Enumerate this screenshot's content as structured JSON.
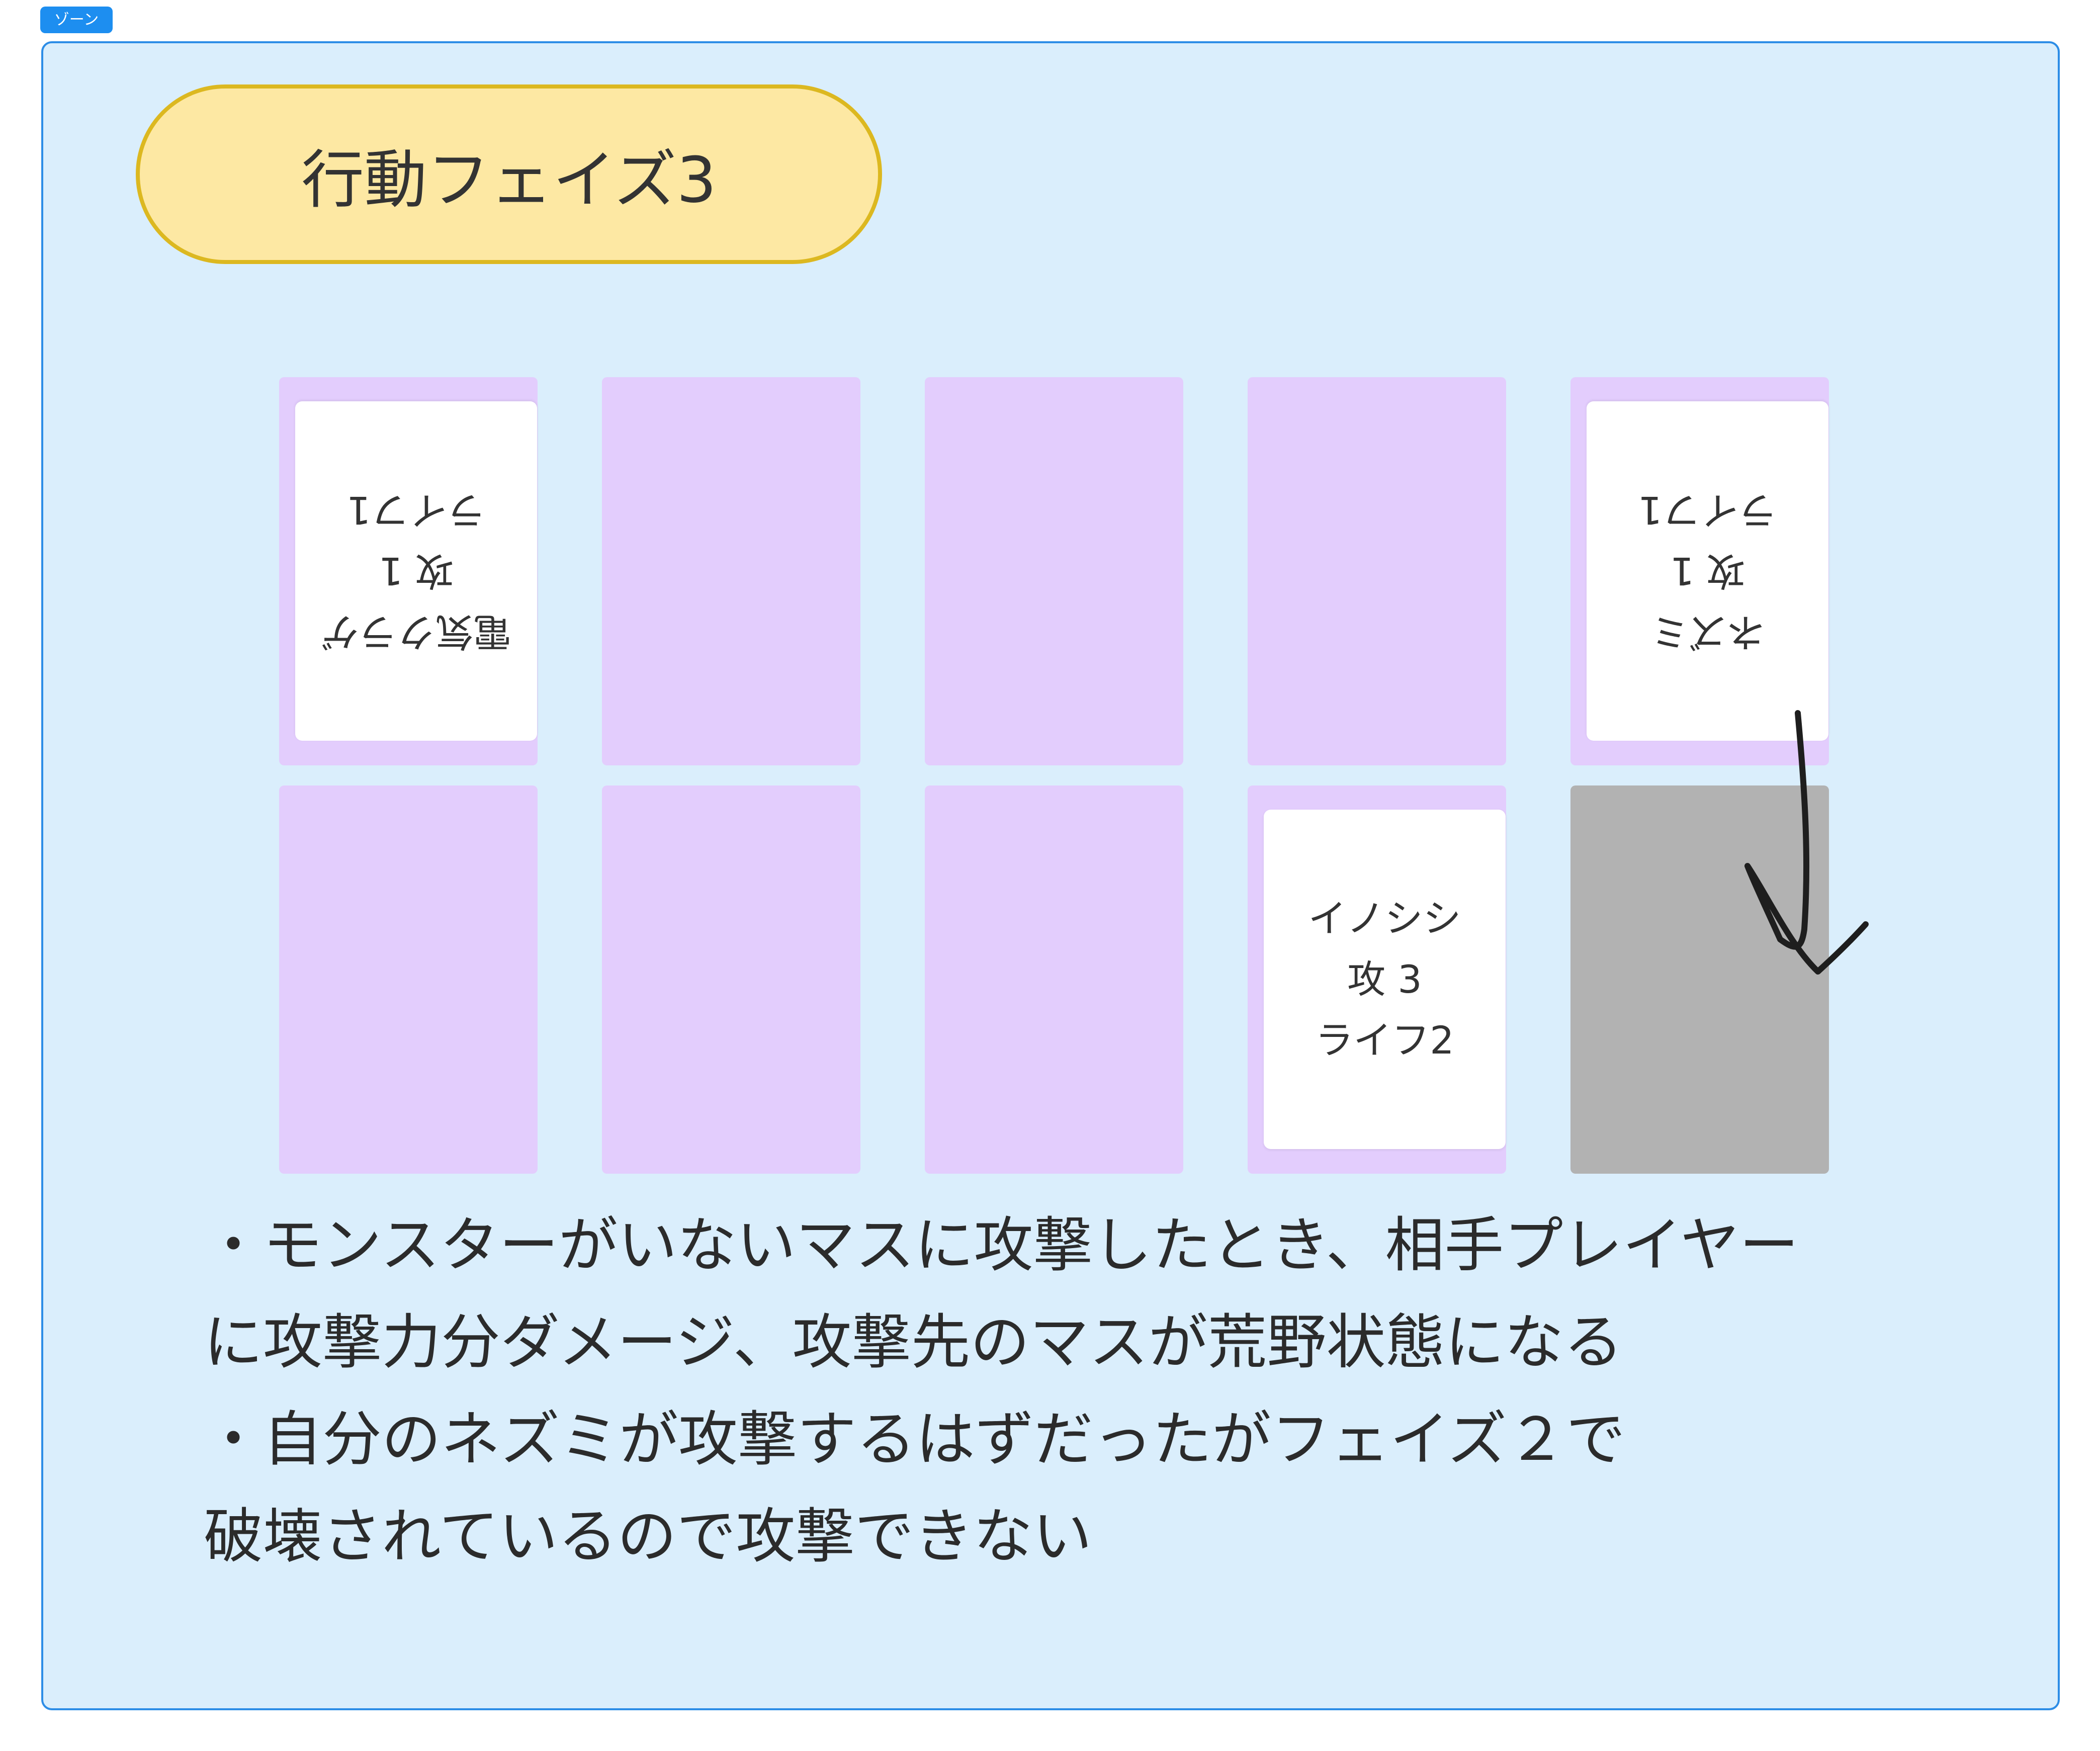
{
  "zone": {
    "label": "ゾーン"
  },
  "phase": {
    "title": "行動フェイズ3"
  },
  "board": {
    "opponent_cards": {
      "left": {
        "name": "電気クラゲ",
        "attack": "攻 1",
        "life": "ライフ1"
      },
      "right": {
        "name": "ネズミ",
        "attack": "攻 1",
        "life": "ライフ1"
      }
    },
    "player_cards": {
      "boar": {
        "name": "イノシシ",
        "attack": "攻 3",
        "life": "ライフ2"
      }
    }
  },
  "description": {
    "lines": [
      "・モンスターがいないマスに攻撃したとき、相手プレイヤー",
      "に攻撃力分ダメージ、攻撃先のマスが荒野状態になる",
      "・自分のネズミが攻撃するはずだったがフェイズ２で",
      "破壊されているので攻撃できない"
    ]
  },
  "colors": {
    "zone_background": "#daeefc",
    "zone_border": "#2d8de6",
    "pill_fill": "#fde8a3",
    "pill_border": "#dcb820",
    "slot": "#e3cdfd",
    "wasteland_slot": "#b2b2b2",
    "card": "#ffffff"
  }
}
